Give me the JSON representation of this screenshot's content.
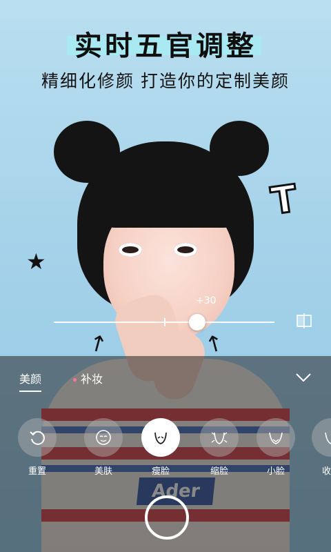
{
  "headline": {
    "title": "实时五官调整",
    "subtitle": "精细化修颜 打造你的定制美颜"
  },
  "slider": {
    "value_label": "+30",
    "value": 30
  },
  "panel": {
    "tabs": [
      {
        "label": "美颜",
        "active": true
      },
      {
        "label": "补妆",
        "active": false
      }
    ],
    "tools": [
      {
        "label": "重置",
        "icon": "reset-icon"
      },
      {
        "label": "美肤",
        "icon": "skin-icon"
      },
      {
        "label": "瘦脸",
        "icon": "slim-face-icon",
        "active": true
      },
      {
        "label": "缩脸",
        "icon": "shrink-face-icon"
      },
      {
        "label": "小脸",
        "icon": "small-face-icon"
      },
      {
        "label": "收下",
        "icon": "chin-icon"
      }
    ]
  },
  "colors": {
    "accent": "#ff6fa8",
    "headline_highlight": "#a7ecf2"
  }
}
